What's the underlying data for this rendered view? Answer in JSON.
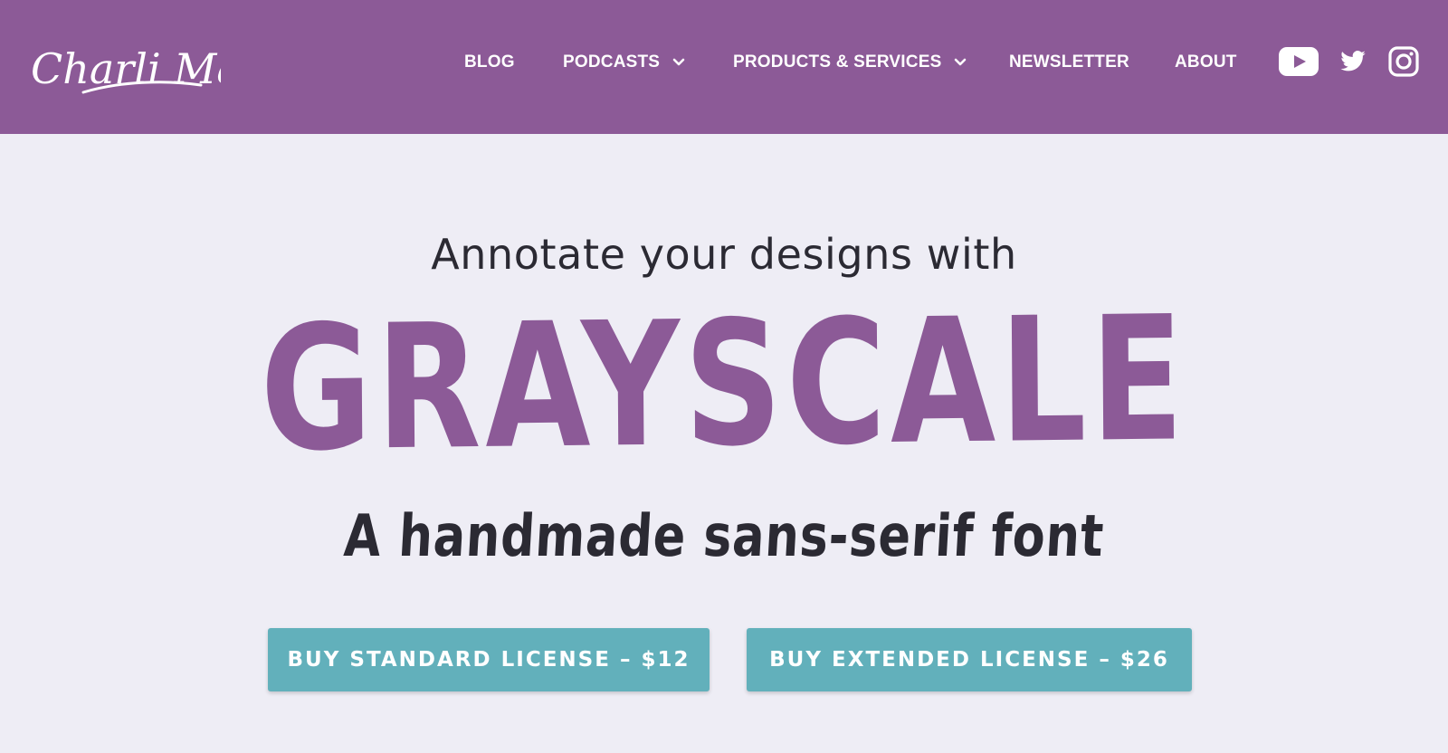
{
  "brand": {
    "logo_text": "Charli Marie"
  },
  "nav": {
    "items": [
      {
        "label": "BLOG",
        "dropdown": false
      },
      {
        "label": "PODCASTS",
        "dropdown": true
      },
      {
        "label": "PRODUCTS & SERVICES",
        "dropdown": true
      },
      {
        "label": "NEWSLETTER",
        "dropdown": false
      },
      {
        "label": "ABOUT",
        "dropdown": false
      }
    ],
    "social": [
      "youtube-icon",
      "twitter-icon",
      "instagram-icon"
    ]
  },
  "hero": {
    "intro": "Annotate your designs with",
    "title": "GRAYSCALE",
    "subtitle": "A handmade sans-serif font",
    "buttons": {
      "standard": "BUY STANDARD LICENSE – $12",
      "extended": "BUY EXTENDED LICENSE – $26"
    }
  },
  "colors": {
    "header_bg": "#8c5a97",
    "page_bg": "#eeedf5",
    "accent": "#8c5a97",
    "button": "#62b0bb",
    "text": "#2b2a33"
  }
}
